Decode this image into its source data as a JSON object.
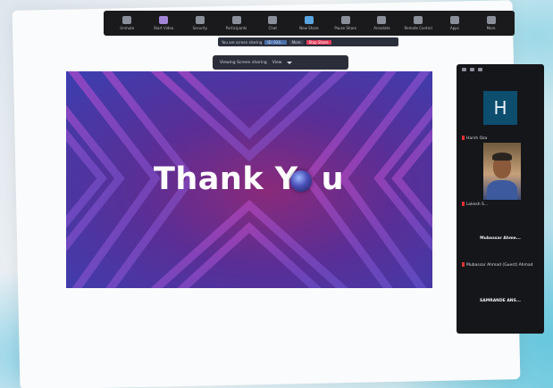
{
  "toolbar": {
    "items": [
      {
        "label": "Unmute",
        "icon": "microphone-icon",
        "color": "#8a8f9a"
      },
      {
        "label": "Start Video",
        "icon": "video-camera-icon",
        "color": "#a184d6"
      },
      {
        "label": "Security",
        "icon": "shield-icon",
        "color": "#8a8f9a"
      },
      {
        "label": "Participants",
        "icon": "people-icon",
        "color": "#8a8f9a"
      },
      {
        "label": "Chat",
        "icon": "chat-icon",
        "color": "#8a8f9a"
      },
      {
        "label": "New Share",
        "icon": "share-screen-icon",
        "color": "#5aa5e0"
      },
      {
        "label": "Pause Share",
        "icon": "pause-icon",
        "color": "#8a8f9a"
      },
      {
        "label": "Annotate",
        "icon": "pen-icon",
        "color": "#8a8f9a"
      },
      {
        "label": "Remote Control",
        "icon": "remote-control-icon",
        "color": "#8a8f9a"
      },
      {
        "label": "Apps",
        "icon": "apps-icon",
        "color": "#8a8f9a"
      },
      {
        "label": "More",
        "icon": "more-icon",
        "color": "#8a8f9a"
      }
    ]
  },
  "share_bar": {
    "status": "You are screen sharing",
    "meeting_id": "ID: 934...",
    "more": "More",
    "stop": "Stop Share"
  },
  "view_options": {
    "label": "Viewing Screen sharing",
    "option": "View"
  },
  "slide": {
    "text_before": "Thank Y",
    "text_after": "u",
    "colors": {
      "deep": "#3b3fb0",
      "mid": "#5a2e96",
      "accent": "#8a2a7a",
      "stripe": "#d94bd0"
    }
  },
  "panel": {
    "avatar_letter": "H",
    "participants": [
      {
        "name": "Harsh Oza"
      },
      {
        "name": "Lokesh S..."
      },
      {
        "name": "Mubassar Ahme..."
      },
      {
        "name": "Mubassar Ahmad (Guest) Ahmad"
      },
      {
        "name": "SAMRANDE ANS..."
      }
    ]
  }
}
